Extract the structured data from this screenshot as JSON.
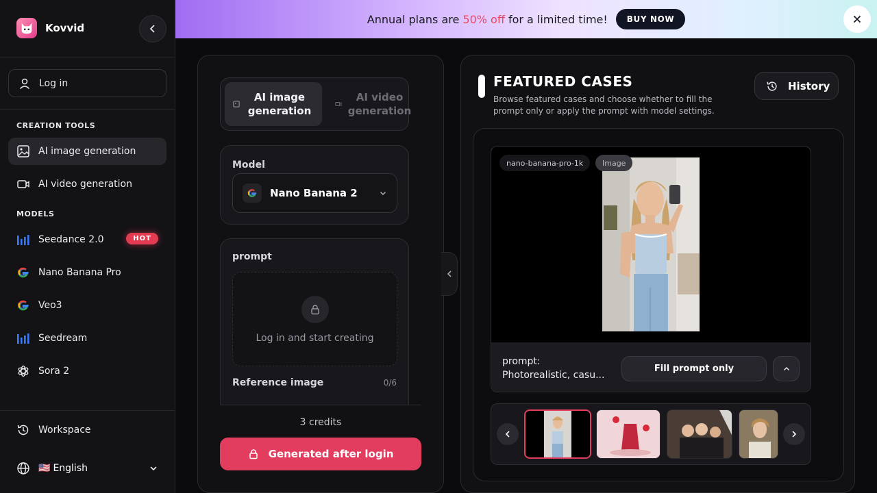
{
  "sidebar": {
    "brand_name": "Kovvid",
    "login_label": "Log in",
    "creation_tools_label": "CREATION TOOLS",
    "tools": [
      {
        "label": "AI image generation",
        "icon": "image-icon",
        "active": true
      },
      {
        "label": "AI video generation",
        "icon": "video-icon",
        "active": false
      }
    ],
    "models_label": "MODELS",
    "models": [
      {
        "label": "Seedance 2.0",
        "icon": "bars-icon",
        "badge": "HOT"
      },
      {
        "label": "Nano Banana Pro",
        "icon": "google-icon"
      },
      {
        "label": "Veo3",
        "icon": "google-icon"
      },
      {
        "label": "Seedream",
        "icon": "bars-icon"
      },
      {
        "label": "Sora 2",
        "icon": "openai-icon"
      }
    ],
    "workspace_label": "Workspace",
    "language_flag": "🇺🇸",
    "language_label": "English"
  },
  "banner": {
    "text_before": "Annual plans are ",
    "highlight": "50% off",
    "text_after": " for a limited time!",
    "cta": "BUY NOW",
    "highlight_color": "#f0445c"
  },
  "generator": {
    "tabs": [
      {
        "label": "AI image generation",
        "active": true
      },
      {
        "label": "AI video generation",
        "active": false
      }
    ],
    "model_title": "Model",
    "model_value": "Nano Banana 2",
    "prompt_title": "prompt",
    "prompt_hint": "Log in and start creating",
    "reference_title": "Reference image",
    "reference_count": "0/6",
    "credits": "3 credits",
    "generate_label": "Generated after login",
    "accent_color": "#e23d5e"
  },
  "featured": {
    "title": "FEATURED CASES",
    "description": "Browse featured cases and choose whether to fill the prompt only or apply the prompt with model settings.",
    "history_label": "History",
    "case": {
      "model_tag": "nano-banana-pro-1k",
      "type_tag": "Image",
      "prompt_label": "prompt:",
      "prompt_preview": "Photorealistic, casu...",
      "fill_label": "Fill prompt only"
    }
  }
}
